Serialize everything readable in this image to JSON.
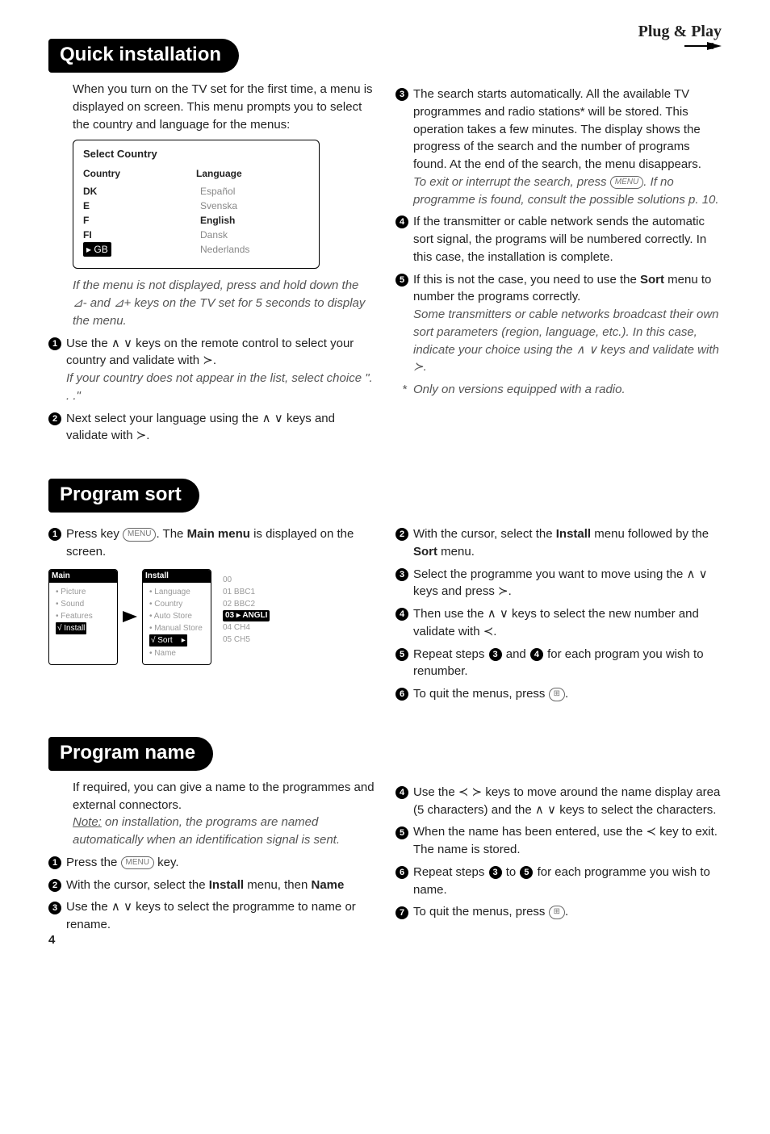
{
  "brand": {
    "label": "Plug & Play"
  },
  "quick": {
    "title": "Quick installation",
    "intro": "When you turn on the TV set for the first time, a menu is displayed on screen. This menu prompts you to select the country and language for the menus:",
    "osd": {
      "title": "Select Country",
      "col1": "Country",
      "col2": "Language",
      "countries": [
        "DK",
        "E",
        "F",
        "FI"
      ],
      "country_sel": "▸ GB",
      "langs": [
        "Español",
        "Svenska"
      ],
      "lang_sel": "English",
      "langs2": [
        "Dansk",
        "Nederlands"
      ]
    },
    "note1": "If the menu is not displayed, press and hold down the ⊿- and ⊿+ keys on the TV set for 5 seconds to display the menu.",
    "s1": "Use the ∧ ∨ keys on the remote control to select your country and validate with ≻.",
    "s1i": "If your country does not appear in the list, select choice \". . .\"",
    "s2": "Next select your language using the ∧ ∨ keys and validate with ≻.",
    "s3a": "The search starts automatically. All the available TV programmes and radio stations* will be stored. This operation takes a few minutes. The display shows the progress of the search and the number of programs found.  At the end of the search, the menu disappears.",
    "s3i": "To exit or interrupt the search, press ",
    "s3i2": ". If no programme is found, consult the possible solutions p. 10.",
    "s4": "If the transmitter or cable network sends the automatic sort signal, the programs will be numbered correctly. In this case, the installation is complete.",
    "s5a": "If this is not the case, you need to use the ",
    "s5b": "Sort",
    "s5c": " menu to number the programs correctly.",
    "s5i": "Some transmitters or cable networks broadcast their own sort parameters (region, language, etc.). In this case, indicate your choice using the ∧ ∨ keys and validate with ≻.",
    "foot": "Only on versions equipped with a radio."
  },
  "sort": {
    "title": "Program sort",
    "s1a": "Press key ",
    "s1b": ". The ",
    "s1c": "Main menu",
    "s1d": " is displayed on the screen.",
    "panelMain": {
      "hdr": "Main",
      "items": [
        "• Picture",
        "• Sound",
        "• Features"
      ],
      "sel": "√ Install"
    },
    "panelInstall": {
      "hdr": "Install",
      "items": [
        "• Language",
        "• Country",
        "• Auto Store",
        "• Manual Store"
      ],
      "sel": "√ Sort",
      "sel_arrow": "▸",
      "last": "• Name"
    },
    "panelChan": {
      "items": [
        "00",
        "01  BBC1",
        "02  BBC2"
      ],
      "sel": "03 ▸ ANGLI",
      "items2": [
        "04  CH4",
        "05  CH5"
      ]
    },
    "s2a": "With the cursor, select the ",
    "s2b": "Install",
    "s2c": " menu followed by the ",
    "s2d": "Sort",
    "s2e": " menu.",
    "s3": "Select the programme you want to move using the ∧ ∨ keys and press ≻.",
    "s4": "Then use the ∧ ∨ keys to select the new number and validate with ≺.",
    "s5a": "Repeat steps ",
    "s5b": " and ",
    "s5c": " for each program you wish to renumber.",
    "s6": "To quit the menus, press "
  },
  "name": {
    "title": "Program name",
    "intro": "If required, you can give a name to the programmes and external connectors.",
    "introI": "Note: on installation, the programs are named automatically when an identification signal is sent.",
    "s1": "Press the ",
    "s1b": " key.",
    "s2a": "With the cursor, select the ",
    "s2b": "Install",
    "s2c": " menu, then ",
    "s2d": "Name",
    "s3": "Use the ∧ ∨ keys to select the programme to name or rename.",
    "s4": "Use the ≺ ≻ keys to move around the name display area (5 characters) and the ∧ ∨ keys to select the characters.",
    "s5": "When the name has been entered, use the ≺ key to exit. The name is stored.",
    "s6a": "Repeat steps ",
    "s6b": " to ",
    "s6c": " for each programme you wish to name.",
    "s7": "To quit the menus, press "
  },
  "keys": {
    "menu": "MENU",
    "exit": "⊞"
  },
  "pageno": "4"
}
